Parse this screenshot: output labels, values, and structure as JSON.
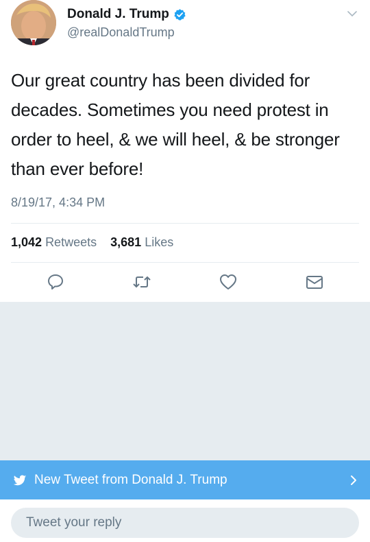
{
  "tweet": {
    "author_name": "Donald J. Trump",
    "author_handle": "@realDonaldTrump",
    "verified": true,
    "text": "Our great country has been divided for decades. Sometimes you need protest in order to heel, & we will heel, & be stronger than ever before!",
    "timestamp": "8/19/17, 4:34 PM",
    "retweets_count": "1,042",
    "retweets_label": "Retweets",
    "likes_count": "3,681",
    "likes_label": "Likes"
  },
  "actions": [
    {
      "icon": "reply-icon"
    },
    {
      "icon": "retweet-icon"
    },
    {
      "icon": "heart-icon"
    },
    {
      "icon": "message-icon"
    }
  ],
  "banner": {
    "icon": "twitter-bird-icon",
    "label": "New Tweet from Donald J. Trump"
  },
  "reply": {
    "placeholder": "Tweet your reply"
  },
  "colors": {
    "accent": "#1da1f2",
    "banner": "#55acee",
    "secondary_text": "#657786",
    "feed_background": "#e6ecf0"
  }
}
